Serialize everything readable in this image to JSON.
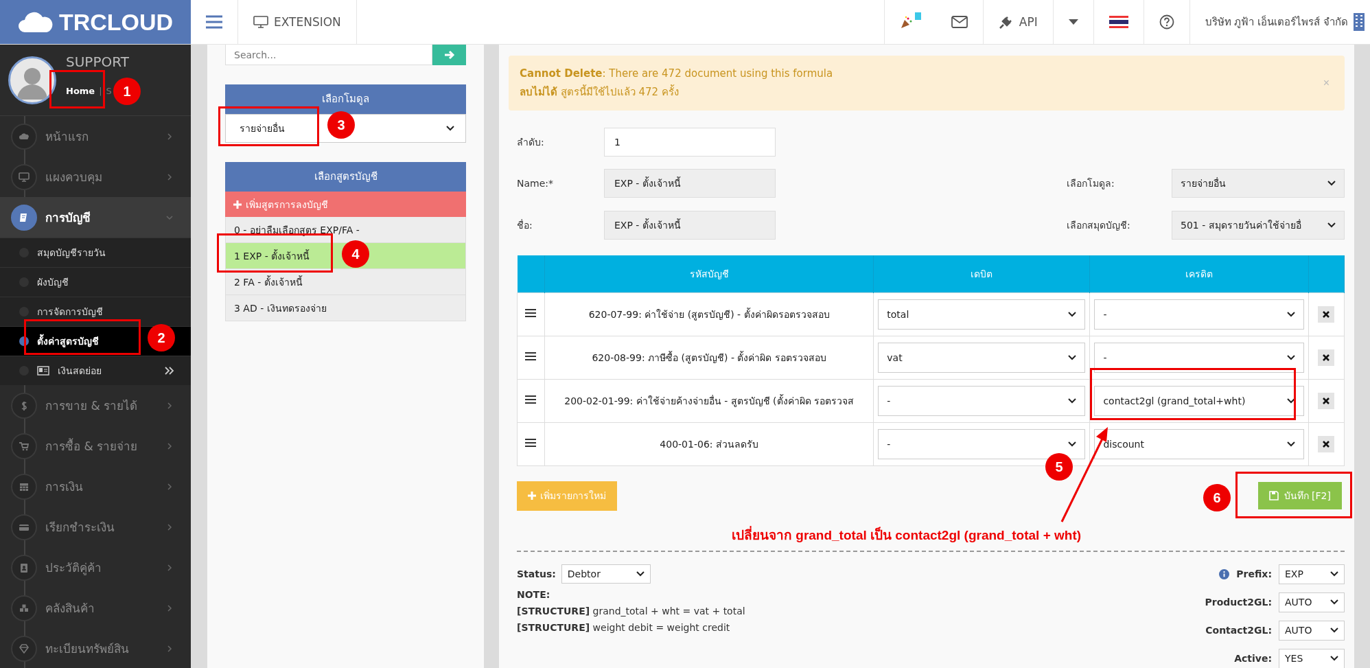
{
  "header": {
    "logo": "TRCLOUD",
    "nav_item": "EXTENSION",
    "api": "API",
    "company": "บริษัท ภูฟ้า เอ็นเตอร์ไพรส์ จำกัด"
  },
  "profile": {
    "name": "SUPPORT",
    "link": "Home",
    "separator": "|",
    "cut_text": "S"
  },
  "sidebar": {
    "items": [
      {
        "label": "หน้าแรก",
        "selected": false,
        "expanded": false
      },
      {
        "label": "แผงควบคุม",
        "selected": false,
        "expanded": false
      },
      {
        "label": "การบัญชี",
        "selected": true,
        "expanded": true,
        "children": [
          {
            "label": "สมุดบัญชีรายวัน",
            "selected": false
          },
          {
            "label": "ผังบัญชี",
            "selected": false
          },
          {
            "label": "การจัดการบัญชี",
            "selected": false
          },
          {
            "label": "ตั้งค่าสูตรบัญชี",
            "selected": true
          },
          {
            "label": "เงินสดย่อย",
            "selected": false,
            "kind": "submenu"
          }
        ]
      },
      {
        "label": "การขาย & รายได้",
        "selected": false,
        "expanded": false
      },
      {
        "label": "การซื้อ & รายจ่าย",
        "selected": false,
        "expanded": false
      },
      {
        "label": "การเงิน",
        "selected": false,
        "expanded": false
      },
      {
        "label": "เรียกชำระเงิน",
        "selected": false,
        "expanded": false
      },
      {
        "label": "ประวัติคู่ค้า",
        "selected": false,
        "expanded": false
      },
      {
        "label": "คลังสินค้า",
        "selected": false,
        "expanded": false
      },
      {
        "label": "ทะเบียนทรัพย์สิน",
        "selected": false,
        "expanded": false
      }
    ]
  },
  "module_panel": {
    "search": {
      "placeholder": "Search..."
    },
    "module_title": "เลือกโมดูล",
    "module_value": "รายจ่ายอื่น",
    "formula_title": "เลือกสูตรบัญชี",
    "add_formula": "เพิ่มสูตรการลงบัญชี",
    "formulas": [
      {
        "label": "0 - อย่าลืมเลือกสูตร EXP/FA -",
        "selected": false
      },
      {
        "label": "1 EXP - ตั้งเจ้าหนี้",
        "selected": true
      },
      {
        "label": "2 FA - ตั้งเจ้าหนี้",
        "selected": false
      },
      {
        "label": "3 AD - เงินทดรองจ่าย",
        "selected": false
      }
    ]
  },
  "alert": {
    "lines": [
      "**Cannot Delete**: There are 472 document using this formula",
      "**ลบไม่ได้** สูตรนี้มีใช้ไปแล้ว 472 ครั้ง"
    ],
    "close": "×"
  },
  "form": {
    "order": {
      "label": "ลำดับ:",
      "value": "1",
      "disabled": false
    },
    "rows": [
      {
        "label": "Name:*",
        "value": "EXP - ตั้งเจ้าหนี้",
        "disabled": true,
        "side_label": "เลือกโมดูล:",
        "side_value": "รายจ่ายอื่น"
      },
      {
        "label": "ชื่อ:",
        "value": "EXP - ตั้งเจ้าหนี้",
        "disabled": true,
        "side_label": "เลือกสมุดบัญชี:",
        "side_value": "501 - สมุดรายวันค่าใช้จ่ายอื่"
      }
    ]
  },
  "table": {
    "columns": [
      "รหัสบัญชี",
      "เดบิต",
      "เครดิต"
    ],
    "rows": [
      {
        "account": "620-07-99: ค่าใช้จ่าย (สูตรบัญชี) - ตั้งค่าผิดรอตรวจสอบ",
        "debit": "total",
        "credit": "-"
      },
      {
        "account": "620-08-99: ภาษีซื้อ (สูตรบัญชี) - ตั้งค่าผิด รอตรวจสอบ",
        "debit": "vat",
        "credit": "-"
      },
      {
        "account": "200-02-01-99: ค่าใช้จ่ายค้างจ่ายอื่น - สูตรบัญชี (ตั้งค่าผิด รอตรวจส",
        "debit": "-",
        "credit": "contact2gl (grand_total+wht)"
      },
      {
        "account": "400-01-06: ส่วนลดรับ",
        "debit": "-",
        "credit": "discount"
      }
    ]
  },
  "add_row_button": "เพิ่มรายการใหม่",
  "save_button": "บันทึก [F2]",
  "footer": {
    "status_label": "Status:",
    "status_value": "Debtor",
    "note_label": "NOTE:",
    "notes": [
      "**[STRUCTURE]** grand_total + wht = vat + total",
      "**[STRUCTURE]** weight debit = weight credit"
    ],
    "settings": [
      {
        "label": "Prefix:",
        "value": "EXP",
        "info": true
      },
      {
        "label": "Product2GL:",
        "value": "AUTO",
        "info": false
      },
      {
        "label": "Contact2GL:",
        "value": "AUTO",
        "info": false
      },
      {
        "label": "Active:",
        "value": "YES",
        "info": false
      }
    ]
  },
  "annotations": {
    "markers": [
      "1",
      "2",
      "3",
      "4",
      "5",
      "6"
    ],
    "caption": "เปลี่ยนจาก grand_total  เป็น  contact2gl (grand_total + wht)"
  }
}
